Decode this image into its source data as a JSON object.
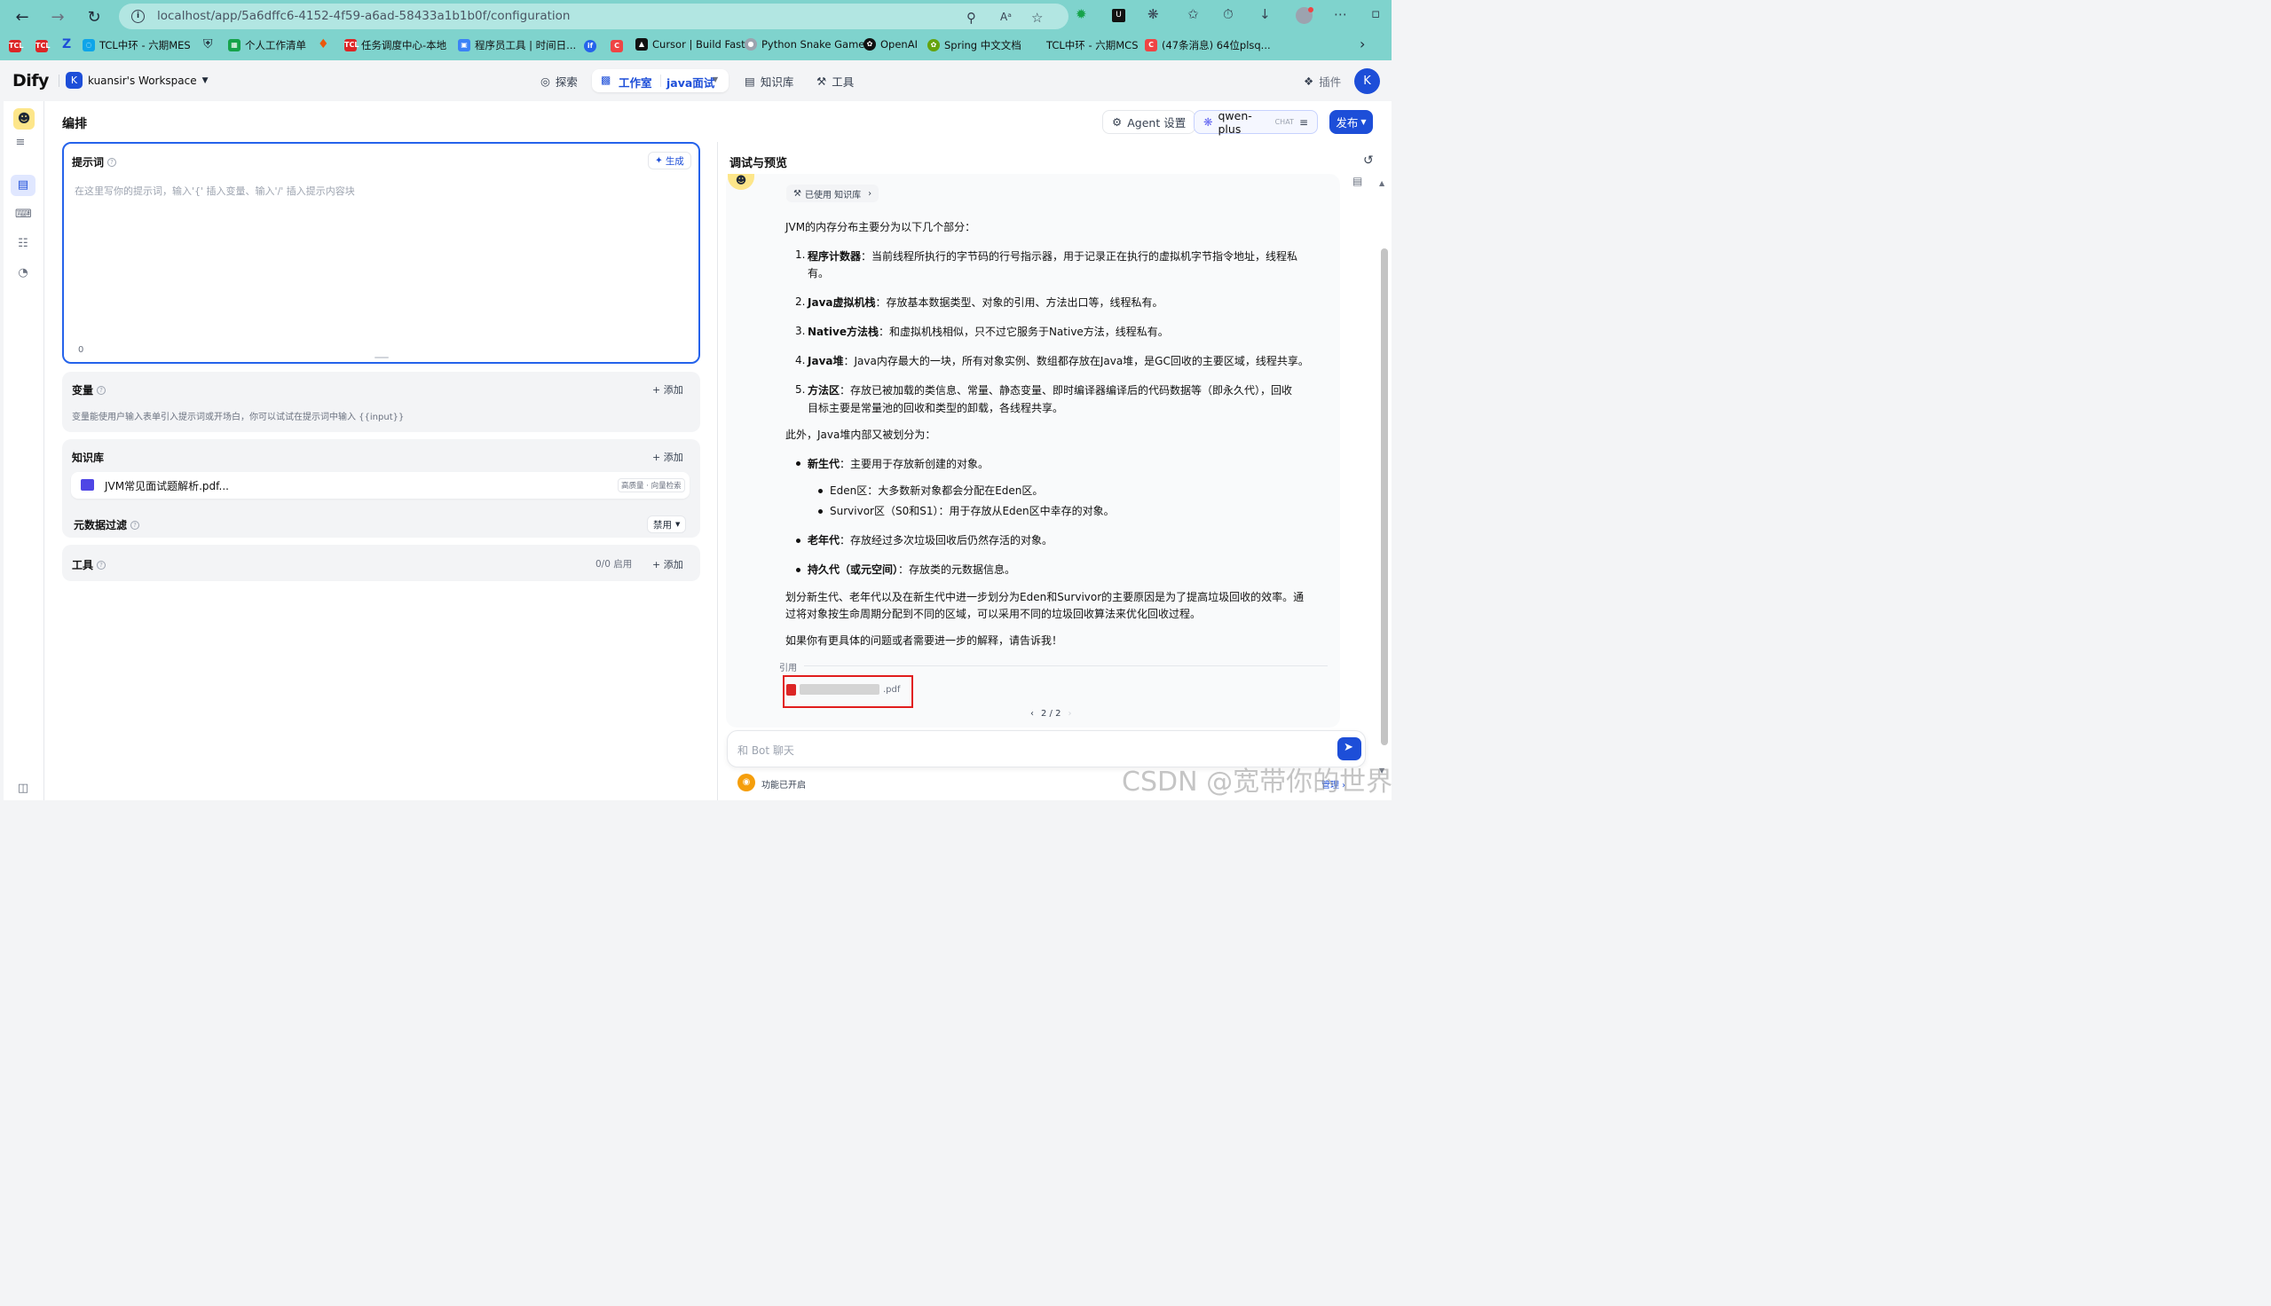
{
  "browser": {
    "url_host": "localhost",
    "url_path": "/app/5a6dffc6-4152-4f59-a6ad-58433a1b1b0f/configuration",
    "bookmarks": [
      {
        "label": "TCL中环 - 六期MES"
      },
      {
        "label": "个人工作清单"
      },
      {
        "label": "任务调度中心-本地"
      },
      {
        "label": "程序员工具 | 时间日..."
      },
      {
        "label": "Cursor | Build Fast"
      },
      {
        "label": "Python Snake Game"
      },
      {
        "label": "OpenAI"
      },
      {
        "label": "Spring 中文文档"
      },
      {
        "label": "TCL中环 - 六期MCS"
      },
      {
        "label": "(47条消息) 64位plsq..."
      }
    ]
  },
  "app": {
    "logo": "Dify",
    "workspace_initial": "K",
    "workspace": "kuansir's Workspace",
    "nav": {
      "explore": "探索",
      "studio": "工作室",
      "app_name": "java面试",
      "knowledge": "知识库",
      "tools": "工具",
      "plugins": "插件"
    },
    "avatar": "K"
  },
  "header": {
    "title": "编排",
    "agent_settings": "Agent 设置",
    "model": "qwen-plus",
    "model_tag": "CHAT",
    "publish": "发布"
  },
  "prompt": {
    "label": "提示词",
    "generate": "生成",
    "placeholder": "在这里写你的提示词，输入'{' 插入变量、输入'/' 插入提示内容块",
    "count": "0"
  },
  "variables": {
    "label": "变量",
    "add": "添加",
    "desc": "变量能使用户输入表单引入提示词或开场白，你可以试试在提示词中输入 {{input}}"
  },
  "knowledge": {
    "label": "知识库",
    "add": "添加",
    "file": "JVM常见面试题解析.pdf...",
    "file_tag": "高质量 · 向量检索"
  },
  "metadata": {
    "label": "元数据过滤",
    "value": "禁用"
  },
  "tools": {
    "label": "工具",
    "count": "0/0 启用",
    "add": "添加"
  },
  "debug": {
    "title": "调试与预览",
    "used_kb": "已使用 知识库",
    "intro": "JVM的内存分布主要分为以下几个部分：",
    "items": [
      {
        "n": "1.",
        "b": "程序计数器",
        "t": "：当前线程所执行的字节码的行号指示器，用于记录正在执行的虚拟机字节指令地址，线程私",
        "t2": "有。"
      },
      {
        "n": "2.",
        "b": "Java虚拟机栈",
        "t": "：存放基本数据类型、对象的引用、方法出口等，线程私有。"
      },
      {
        "n": "3.",
        "b": "Native方法栈",
        "t": "：和虚拟机栈相似，只不过它服务于Native方法，线程私有。"
      },
      {
        "n": "4.",
        "b": "Java堆",
        "t": "：Java内存最大的一块，所有对象实例、数组都存放在Java堆，是GC回收的主要区域，线程共享。"
      },
      {
        "n": "5.",
        "b": "方法区",
        "t": "：存放已被加载的类信息、常量、静态变量、即时编译器编译后的代码数据等（即永久代），回收",
        "t2": "目标主要是常量池的回收和类型的卸载，各线程共享。"
      }
    ],
    "also": "此外，Java堆内部又被划分为：",
    "gen": [
      {
        "b": "新生代",
        "t": "：主要用于存放新创建的对象。"
      },
      {
        "b": "老年代",
        "t": "：存放经过多次垃圾回收后仍然存活的对象。"
      },
      {
        "b": "持久代（或元空间）",
        "t": "：存放类的元数据信息。"
      }
    ],
    "sub": [
      "Eden区：大多数新对象都会分配在Eden区。",
      "Survivor区（S0和S1）：用于存放从Eden区中幸存的对象。"
    ],
    "para1": "划分新生代、老年代以及在新生代中进一步划分为Eden和Survivor的主要原因是为了提高垃圾回收的效率。通",
    "para2": "过将对象按生命周期分配到不同的区域，可以采用不同的垃圾回收算法来优化回收过程。",
    "outro": "如果你有更具体的问题或者需要进一步的解释，请告诉我！",
    "cite_label": "引用",
    "cite_file": ".pdf",
    "pager": "2 / 2",
    "input_placeholder": "和 Bot 聊天",
    "features": "功能已开启",
    "manage": "管理"
  },
  "watermark": "CSDN @宽带你的世界",
  "colors": {
    "accent": "#1d4ed8",
    "chrome": "#7fd3cd",
    "highlight": "#e11d1d"
  }
}
